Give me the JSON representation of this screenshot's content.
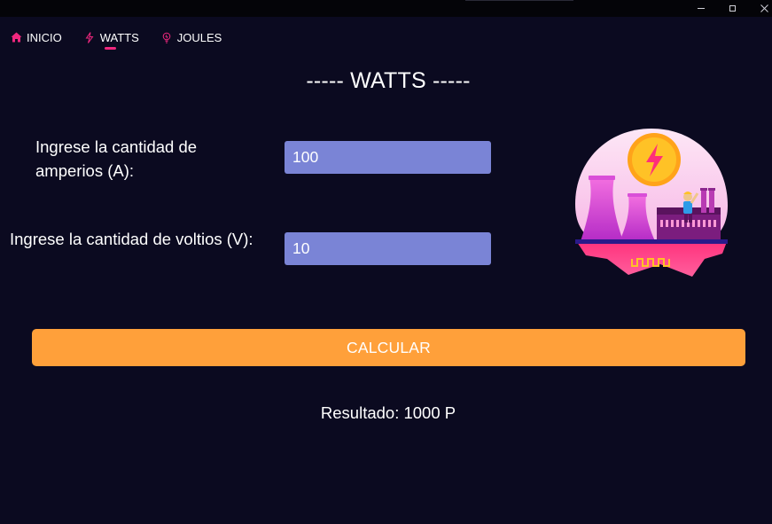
{
  "colors": {
    "background": "#0b0a20",
    "accent_pink": "#f0277e",
    "input_fill": "#7a84d6",
    "button_orange": "#ffa03a"
  },
  "nav": {
    "items": [
      {
        "label": "INICIO",
        "icon": "home-icon"
      },
      {
        "label": "WATTS",
        "icon": "lightning-icon",
        "active": true
      },
      {
        "label": "JOULES",
        "icon": "lightbulb-icon"
      }
    ]
  },
  "main": {
    "title": "----- WATTS -----",
    "amps_label": "Ingrese la cantidad de amperios (A):",
    "amps_value": "100",
    "volts_label": "Ingrese la cantidad de voltios (V):",
    "volts_value": "10",
    "calculate_label": "CALCULAR",
    "result_text": "Resultado: 1000 P",
    "illustration_icon": "power-plant-illustration"
  }
}
